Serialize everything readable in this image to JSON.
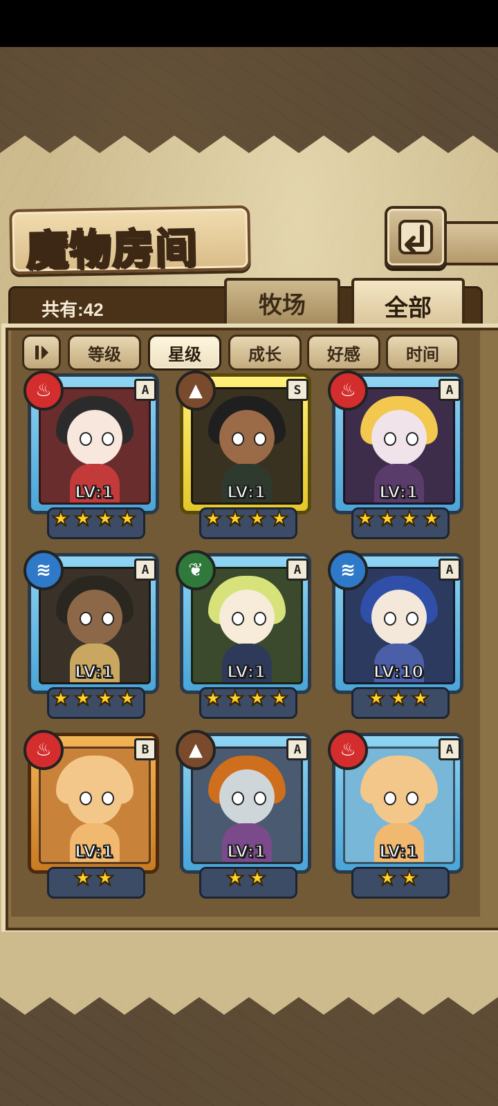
{
  "header": {
    "title": "魔物房间",
    "back_icon": "return-arrow-icon"
  },
  "tabs": {
    "count_label": "共有:42",
    "farm_label": "牧场",
    "all_label": "全部",
    "selected": "全部"
  },
  "filters": {
    "sort_icon": "sort-toggle-icon",
    "items": [
      "等级",
      "星级",
      "成长",
      "好感",
      "时间"
    ],
    "selected": "星级"
  },
  "cards": [
    {
      "element": "fire",
      "rank": "A",
      "level": "LV:1",
      "stars": 4
    },
    {
      "element": "earth",
      "rank": "S",
      "level": "LV:1",
      "stars": 4
    },
    {
      "element": "fire",
      "rank": "A",
      "level": "LV:1",
      "stars": 4
    },
    {
      "element": "water",
      "rank": "A",
      "level": "LV:1",
      "stars": 4
    },
    {
      "element": "wind",
      "rank": "A",
      "level": "LV:1",
      "stars": 4
    },
    {
      "element": "water",
      "rank": "A",
      "level": "LV:10",
      "stars": 3
    },
    {
      "element": "fire",
      "rank": "B",
      "level": "LV:1",
      "stars": 2
    },
    {
      "element": "earth",
      "rank": "A",
      "level": "LV:1",
      "stars": 2
    },
    {
      "element": "fire",
      "rank": "A",
      "level": "LV:1",
      "stars": 2
    }
  ],
  "colors": {
    "rank_A": "#4aa5d8",
    "rank_S": "#e3c72a",
    "rank_B": "#c87b23",
    "fire": "#d42d2d",
    "earth": "#7a4a2c",
    "water": "#2e79c8",
    "wind": "#2f7a3a"
  }
}
